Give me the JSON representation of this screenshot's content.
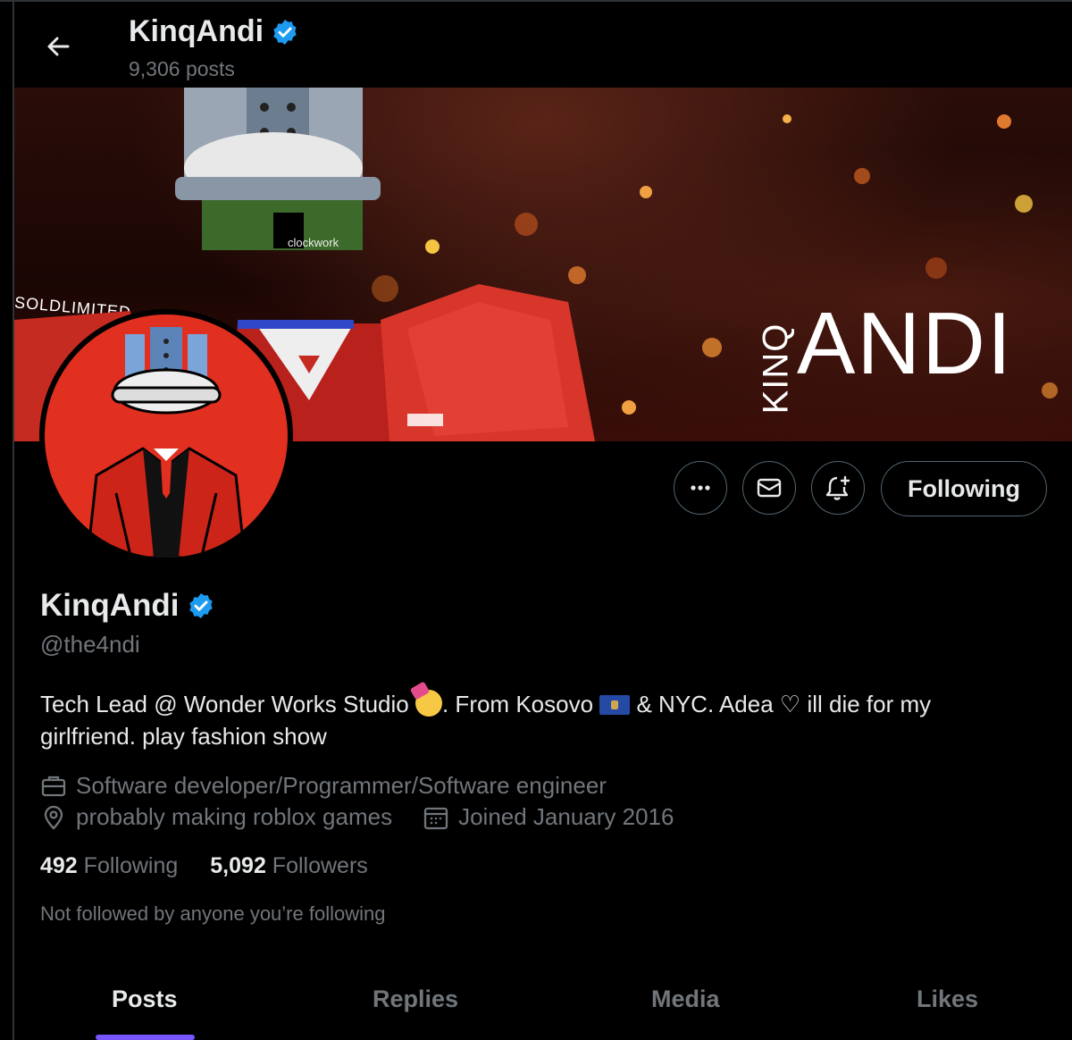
{
  "header": {
    "display_name": "KinqAndi",
    "posts_count": "9,306 posts"
  },
  "banner": {
    "brand_andi": "ANDI",
    "brand_kinq": "KINQ",
    "sold_limited_text": "SOLDLIMITED",
    "clockwork_text": "clockwork"
  },
  "actions": {
    "following_label": "Following"
  },
  "profile": {
    "display_name": "KinqAndi",
    "handle": "@the4ndi",
    "bio_part1": "Tech Lead @ Wonder Works Studio ",
    "bio_part2": ". From Kosovo ",
    "bio_part3": " & NYC. Adea ♡ ill die for my girlfriend. play fashion show",
    "profession": "Software developer/Programmer/Software engineer",
    "location": "probably making roblox games",
    "joined": "Joined January 2016"
  },
  "stats": {
    "following_count": "492",
    "following_label": "Following",
    "followers_count": "5,092",
    "followers_label": "Followers"
  },
  "social_context": "Not followed by anyone you’re following",
  "tabs": [
    {
      "label": "Posts"
    },
    {
      "label": "Replies"
    },
    {
      "label": "Media"
    },
    {
      "label": "Likes"
    }
  ],
  "colors": {
    "verified": "#1d9bf0",
    "accent": "#7856ff",
    "muted_text": "#71767b",
    "avatar_bg": "#e12f20"
  },
  "icons": [
    "back-arrow-icon",
    "verified-badge-icon",
    "more-icon",
    "message-icon",
    "notification-bell-icon",
    "briefcase-icon",
    "location-pin-icon",
    "calendar-icon"
  ]
}
